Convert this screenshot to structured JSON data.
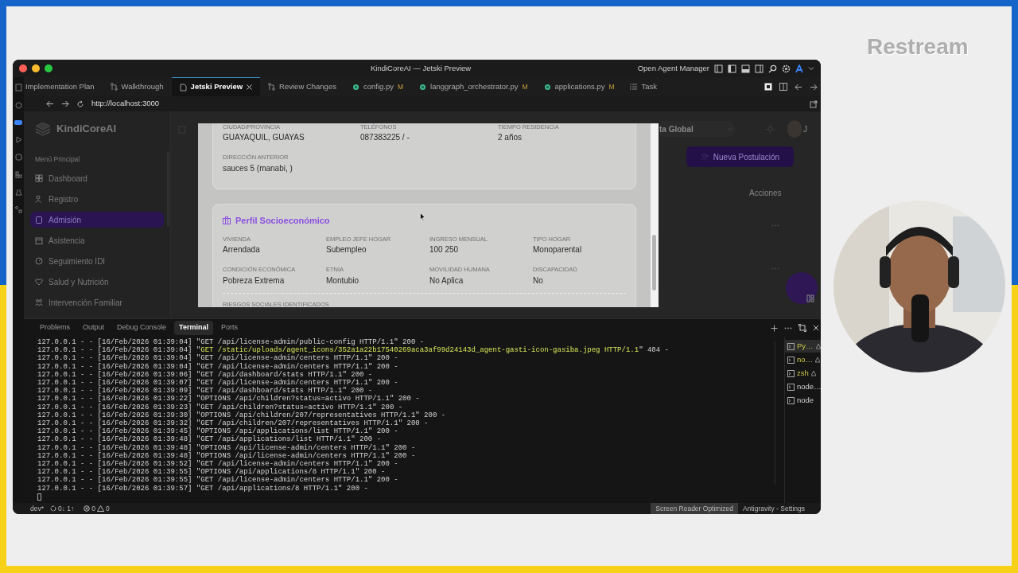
{
  "overlay_logo": "Restream",
  "window": {
    "title": "KindiCoreAI — Jetski Preview",
    "agent_manager": "Open Agent Manager"
  },
  "editor_tabs": [
    {
      "label": "Implementation Plan",
      "kind": "doc",
      "selected": false
    },
    {
      "label": "Walkthrough",
      "kind": "diff",
      "selected": false
    },
    {
      "label": "Jetski Preview",
      "kind": "page",
      "selected": true
    },
    {
      "label": "Review Changes",
      "kind": "diff",
      "selected": false
    },
    {
      "label": "config.py",
      "kind": "python",
      "selected": false,
      "status": "M"
    },
    {
      "label": "langgraph_orchestrator.py",
      "kind": "python",
      "selected": false,
      "status": "M"
    },
    {
      "label": "applications.py",
      "kind": "python",
      "selected": false,
      "status": "M"
    },
    {
      "label": "Task",
      "kind": "list",
      "selected": false
    }
  ],
  "browser": {
    "url": "http://localhost:3000"
  },
  "app": {
    "brand": "KindiCoreAI",
    "menu_heading": "Menú Principal",
    "menu": [
      {
        "label": "Dashboard",
        "selected": false
      },
      {
        "label": "Registro",
        "selected": false
      },
      {
        "label": "Admisión",
        "selected": true
      },
      {
        "label": "Asistencia",
        "selected": false
      },
      {
        "label": "Seguimiento IDI",
        "selected": false
      },
      {
        "label": "Salud y Nutrición",
        "selected": false
      },
      {
        "label": "Intervención Familiar",
        "selected": false
      }
    ],
    "filter": "ta Global",
    "avatar_initial": "J",
    "new_button": "Nueva Postulación",
    "column_heading": "Acciones"
  },
  "modal": {
    "cards": [
      {
        "fields": [
          {
            "label": "CIUDAD/PROVINCIA",
            "value": "GUAYAQUIL, GUAYAS"
          },
          {
            "label": "TELÉFONOS",
            "value": "087383225 / -"
          },
          {
            "label": "TIEMPO RESIDENCIA",
            "value": "2 años"
          },
          {
            "label": "DIRECCIÓN ANTERIOR",
            "value": "sauces 5 (manabi, )"
          }
        ]
      },
      {
        "title": "Perfil Socioeconómico",
        "fields": [
          {
            "label": "VIVIENDA",
            "value": "Arrendada"
          },
          {
            "label": "EMPLEO JEFE HOGAR",
            "value": "Subempleo"
          },
          {
            "label": "INGRESO MENSUAL",
            "value": "100 250"
          },
          {
            "label": "TIPO HOGAR",
            "value": "Monoparental"
          },
          {
            "label": "CONDICIÓN ECONÓMICA",
            "value": "Pobreza Extrema"
          },
          {
            "label": "ETNIA",
            "value": "Montubio"
          },
          {
            "label": "MOVILIDAD HUMANA",
            "value": "No Aplica"
          },
          {
            "label": "DISCAPACIDAD",
            "value": "No"
          }
        ],
        "section_heading": "RIESGOS SOCIALES IDENTIFICADOS"
      }
    ]
  },
  "panel": {
    "tabs": [
      {
        "label": "Problems",
        "selected": false
      },
      {
        "label": "Output",
        "selected": false
      },
      {
        "label": "Debug Console",
        "selected": false
      },
      {
        "label": "Terminal",
        "selected": true
      },
      {
        "label": "Ports",
        "selected": false
      }
    ],
    "lines": [
      {
        "head": "127.0.0.1 - - [16/Feb/2026 01:39:04] \"",
        "request": "GET /api/license-admin/public-config HTTP/1.1",
        "tail": "\" 200 -",
        "highlighted": false
      },
      {
        "head": "127.0.0.1 - - [16/Feb/2026 01:39:04] \"",
        "request": "GET /static/uploads/agent_icons/352a1a22b17540269aca3af99d24143d_agent-gasti-icon-gasiba.jpeg HTTP/1.1",
        "tail": "\" 404 -",
        "highlighted": true
      },
      {
        "head": "127.0.0.1 - - [16/Feb/2026 01:39:04] \"",
        "request": "GET /api/license-admin/centers HTTP/1.1",
        "tail": "\" 200 -",
        "highlighted": false
      },
      {
        "head": "127.0.0.1 - - [16/Feb/2026 01:39:04] \"",
        "request": "GET /api/license-admin/centers HTTP/1.1",
        "tail": "\" 200 -",
        "highlighted": false
      },
      {
        "head": "127.0.0.1 - - [16/Feb/2026 01:39:06] \"",
        "request": "GET /api/dashboard/stats HTTP/1.1",
        "tail": "\" 200 -",
        "highlighted": false
      },
      {
        "head": "127.0.0.1 - - [16/Feb/2026 01:39:07] \"",
        "request": "GET /api/license-admin/centers HTTP/1.1",
        "tail": "\" 200 -",
        "highlighted": false
      },
      {
        "head": "127.0.0.1 - - [16/Feb/2026 01:39:09] \"",
        "request": "GET /api/dashboard/stats HTTP/1.1",
        "tail": "\" 200 -",
        "highlighted": false
      },
      {
        "head": "127.0.0.1 - - [16/Feb/2026 01:39:22] \"",
        "request": "OPTIONS /api/children?status=activo HTTP/1.1",
        "tail": "\" 200 -",
        "highlighted": false
      },
      {
        "head": "127.0.0.1 - - [16/Feb/2026 01:39:23] \"",
        "request": "GET /api/children?status=activo HTTP/1.1",
        "tail": "\" 200 -",
        "highlighted": false
      },
      {
        "head": "127.0.0.1 - - [16/Feb/2026 01:39:30] \"",
        "request": "OPTIONS /api/children/207/representatives HTTP/1.1",
        "tail": "\" 200 -",
        "highlighted": false
      },
      {
        "head": "127.0.0.1 - - [16/Feb/2026 01:39:32] \"",
        "request": "GET /api/children/207/representatives HTTP/1.1",
        "tail": "\" 200 -",
        "highlighted": false
      },
      {
        "head": "127.0.0.1 - - [16/Feb/2026 01:39:45] \"",
        "request": "OPTIONS /api/applications/list HTTP/1.1",
        "tail": "\" 200 -",
        "highlighted": false
      },
      {
        "head": "127.0.0.1 - - [16/Feb/2026 01:39:48] \"",
        "request": "GET /api/applications/list HTTP/1.1",
        "tail": "\" 200 -",
        "highlighted": false
      },
      {
        "head": "127.0.0.1 - - [16/Feb/2026 01:39:48] \"",
        "request": "OPTIONS /api/license-admin/centers HTTP/1.1",
        "tail": "\" 200 -",
        "highlighted": false
      },
      {
        "head": "127.0.0.1 - - [16/Feb/2026 01:39:48] \"",
        "request": "OPTIONS /api/license-admin/centers HTTP/1.1",
        "tail": "\" 200 -",
        "highlighted": false
      },
      {
        "head": "127.0.0.1 - - [16/Feb/2026 01:39:52] \"",
        "request": "GET /api/license-admin/centers HTTP/1.1",
        "tail": "\" 200 -",
        "highlighted": false
      },
      {
        "head": "127.0.0.1 - - [16/Feb/2026 01:39:55] \"",
        "request": "OPTIONS /api/applications/8 HTTP/1.1",
        "tail": "\" 200 -",
        "highlighted": false
      },
      {
        "head": "127.0.0.1 - - [16/Feb/2026 01:39:55] \"",
        "request": "GET /api/license-admin/centers HTTP/1.1",
        "tail": "\" 200 -",
        "highlighted": false
      },
      {
        "head": "127.0.0.1 - - [16/Feb/2026 01:39:57] \"",
        "request": "GET /api/applications/8 HTTP/1.1",
        "tail": "\" 200 -",
        "highlighted": false
      }
    ],
    "terminals": [
      {
        "label": "Py…",
        "selected": true,
        "warning": true
      },
      {
        "label": "no…",
        "selected": false,
        "warning": true
      },
      {
        "label": "zsh",
        "selected": false,
        "warning": true
      },
      {
        "label": "node…",
        "selected": false,
        "warning": false
      },
      {
        "label": "node",
        "selected": false,
        "warning": false
      }
    ]
  },
  "status_bar": {
    "branch": "dev*",
    "sync": "0↓ 1↑",
    "errors": "0",
    "warnings": "0",
    "items": [
      {
        "label": "Screen Reader Optimized",
        "highlighted": true
      },
      {
        "label": "Antigravity - Settings",
        "highlighted": false
      }
    ]
  }
}
